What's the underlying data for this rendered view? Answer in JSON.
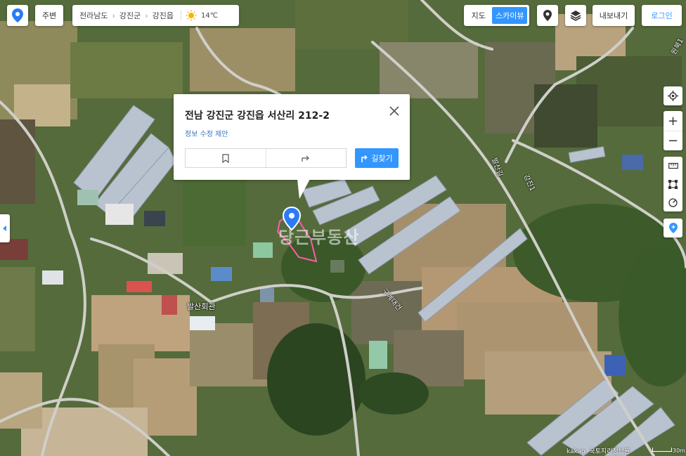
{
  "colors": {
    "accent": "#3396ff",
    "marker": "#2b7bf6",
    "parcel": "#ff5ca8"
  },
  "toolbar": {
    "logo_icon": "kakaomap-logo-icon",
    "nearby_label": "주변",
    "breadcrumb": [
      "전라남도",
      "강진군",
      "강진읍"
    ],
    "weather_icon": "sun-icon",
    "temperature": "14℃"
  },
  "map_types": {
    "map_label": "지도",
    "skyview_label": "스카이뷰",
    "active": "스카이뷰"
  },
  "right_tools": {
    "export_label": "내보내기",
    "login_label": "로그인",
    "side_icons": [
      "my-location-icon",
      "zoom-in-icon",
      "zoom-out-icon",
      "ruler-icon",
      "area-icon",
      "radius-icon",
      "place-marker-icon"
    ]
  },
  "popup": {
    "address": "전남 강진군 강진읍 서산리 212-2",
    "edit_link": "정보 수정 제안",
    "route_label": "길찾기"
  },
  "map_labels": {
    "village": "발산회관",
    "roads": [
      "발산길",
      "강진1",
      "구계대건",
      "원북1"
    ]
  },
  "watermark": "당근부동산",
  "footer": {
    "attribution": "kakao  국토지리정보원",
    "scale": "30m"
  }
}
